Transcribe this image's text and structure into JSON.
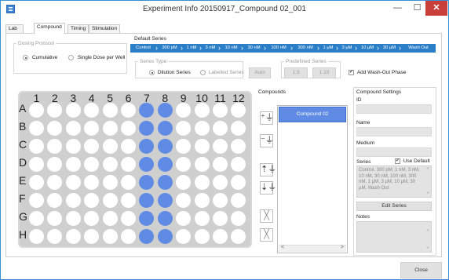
{
  "window": {
    "title": "Experiment Info 20150917_Compound 02_001",
    "min_glyph": "—",
    "max_glyph": "☐",
    "close_glyph": "✕"
  },
  "tabs": [
    {
      "label": "Lab Book"
    },
    {
      "label": "Compound",
      "active": true
    },
    {
      "label": "Timing"
    },
    {
      "label": "Stimulation"
    }
  ],
  "dosing": {
    "legend": "Dosing Protocol",
    "options": [
      {
        "label": "Cumulative",
        "selected": true
      },
      {
        "label": "Single Dose per Well",
        "selected": false
      }
    ]
  },
  "default_series": {
    "label": "Default Series",
    "steps": [
      "Control",
      "300 pM",
      "1 nM",
      "3 nM",
      "10 nM",
      "30 nM",
      "100 nM",
      "300 nM",
      "1 µM",
      "3 µM",
      "10 µM",
      "30 µM",
      "Wash Out"
    ],
    "series_type": {
      "legend": "Series Type",
      "options": [
        {
          "label": "Dilution Series",
          "selected": true
        },
        {
          "label": "Labelled Series",
          "selected": false
        }
      ]
    },
    "auto_label": "Auto",
    "predefined": {
      "legend": "Predefined Series",
      "options": [
        "1:3",
        "1:10"
      ]
    },
    "washout_label": "Add Wash-Out Phase",
    "washout_checked": true
  },
  "plate": {
    "columns": [
      "1",
      "2",
      "3",
      "4",
      "5",
      "6",
      "7",
      "8",
      "9",
      "10",
      "11",
      "12"
    ],
    "rows": [
      "A",
      "B",
      "C",
      "D",
      "E",
      "F",
      "G",
      "H"
    ],
    "selected_columns": [
      7,
      8
    ]
  },
  "compounds": {
    "title": "Compounds",
    "items": [
      "Compound 02"
    ],
    "scroll_left": "<",
    "scroll_right": ">"
  },
  "compound_settings": {
    "title": "Compound Settings",
    "id_label": "ID",
    "name_label": "Name",
    "medium_label": "Medium",
    "series_label": "Series",
    "use_default_label": "Use Default",
    "use_default_checked": true,
    "series_text": "Control, 300 pM, 1 nM, 3 nM, 10 nM, 30 nM, 100 nM, 300 nM, 1 µM, 3 µM, 10 µM, 30 µM, Wash Out",
    "edit_series_label": "Edit Series",
    "notes_label": "Notes"
  },
  "close_label": "Close",
  "colors": {
    "accent": "#2b7fc9",
    "selected_well": "#5f8be4",
    "close_button": "#c9403a"
  }
}
